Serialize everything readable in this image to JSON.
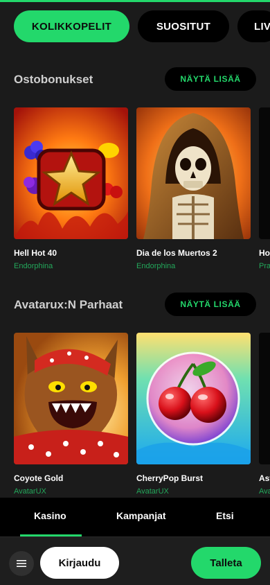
{
  "categories": {
    "items": [
      "KOLIKKOPELIT",
      "SUOSITUT",
      "LIV"
    ],
    "active": "KOLIKKOPELIT"
  },
  "sections": [
    {
      "title": "Ostobonukset",
      "more_label": "NÄYTÄ LISÄÄ",
      "games": [
        {
          "title": "Hell Hot 40",
          "provider": "Endorphina"
        },
        {
          "title": "Dia de los Muertos 2",
          "provider": "Endorphina"
        },
        {
          "title": "Ho",
          "provider": "Pra"
        }
      ]
    },
    {
      "title": "Avatarux:N Parhaat",
      "more_label": "NÄYTÄ LISÄÄ",
      "games": [
        {
          "title": "Coyote Gold",
          "provider": "AvatarUX"
        },
        {
          "title": "CherryPop Burst",
          "provider": "AvatarUX"
        },
        {
          "title": "Ast",
          "provider": "Ava"
        }
      ]
    }
  ],
  "bottom_nav": {
    "items": [
      "Kasino",
      "Kampanjat",
      "Etsi"
    ],
    "active": "Kasino"
  },
  "actions": {
    "menu_icon": "hamburger-icon",
    "login_label": "Kirjaudu",
    "deposit_label": "Talleta"
  },
  "colors": {
    "accent": "#23d86b",
    "background": "#1b1b1b"
  }
}
